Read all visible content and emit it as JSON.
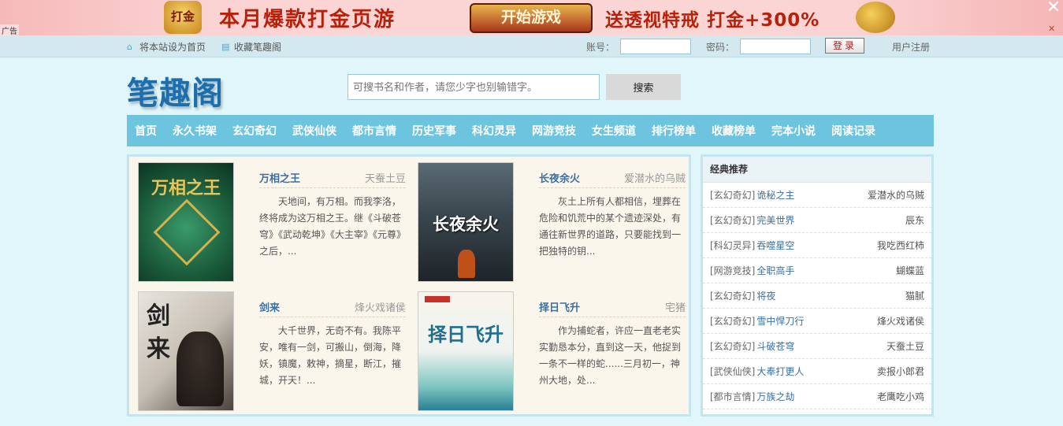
{
  "ad": {
    "label": "广告",
    "logo_text": "打金",
    "text1": "本月爆款打金页游",
    "button": "开始游戏",
    "text2": "送透视特戒 打金+300%",
    "close": "✕",
    "corner": "✕"
  },
  "topbar": {
    "set_home": "将本站设为首页",
    "bookmark": "收藏笔趣阁",
    "account_label": "账号：",
    "password_label": "密码：",
    "login": "登录",
    "register": "用户注册"
  },
  "logo": "笔趣阁",
  "search": {
    "placeholder": "可搜书名和作者，请您少字也别输错字。",
    "button": "搜索"
  },
  "nav": [
    "首页",
    "永久书架",
    "玄幻奇幻",
    "武侠仙侠",
    "都市言情",
    "历史军事",
    "科幻灵异",
    "网游竞技",
    "女生频道",
    "排行榜单",
    "收藏榜单",
    "完本小说",
    "阅读记录"
  ],
  "books": [
    {
      "title": "万相之王",
      "author": "天蚕土豆",
      "desc": "天地间，有万相。而我李洛，终将成为这万相之王。继《斗破苍穹》《武动乾坤》《大主宰》《元尊》之后，...",
      "cover_text": "万相之王"
    },
    {
      "title": "长夜余火",
      "author": "爱潜水的乌贼",
      "desc": "灰土上所有人都相信，埋葬在危险和饥荒中的某个遗迹深处，有通往新世界的道路，只要能找到一把独特的钥...",
      "cover_text": "长夜余火"
    },
    {
      "title": "剑来",
      "author": "烽火戏诸侯",
      "desc": "大千世界，无奇不有。我陈平安，唯有一剑，可搬山，倒海，降妖，镇魔，敕神，摘星，断江，摧城，开天！...",
      "cover_text": "剑来"
    },
    {
      "title": "择日飞升",
      "author": "宅猪",
      "desc": "作为捕蛇者，许应一直老老实实勤恳本分，直到这一天，他捉到一条不一样的蛇......三月初一，神州大地，处...",
      "cover_text": "择日飞升"
    }
  ],
  "classic": {
    "heading": "经典推荐",
    "items": [
      {
        "cat": "[玄幻奇幻]",
        "name": "诡秘之主",
        "author": "爱潜水的乌贼"
      },
      {
        "cat": "[玄幻奇幻]",
        "name": "完美世界",
        "author": "辰东"
      },
      {
        "cat": "[科幻灵异]",
        "name": "吞噬星空",
        "author": "我吃西红柿"
      },
      {
        "cat": "[网游竞技]",
        "name": "全职高手",
        "author": "蝴蝶蓝"
      },
      {
        "cat": "[玄幻奇幻]",
        "name": "将夜",
        "author": "猫腻"
      },
      {
        "cat": "[玄幻奇幻]",
        "name": "雪中悍刀行",
        "author": "烽火戏诸侯"
      },
      {
        "cat": "[玄幻奇幻]",
        "name": "斗破苍穹",
        "author": "天蚕土豆"
      },
      {
        "cat": "[武侠仙侠]",
        "name": "大奉打更人",
        "author": "卖报小郎君"
      },
      {
        "cat": "[都市言情]",
        "name": "万族之劫",
        "author": "老鹰吃小鸡"
      }
    ]
  },
  "colors": {
    "accent": "#6cc4de",
    "link": "#3a6fa0",
    "logo": "#1b6fae"
  }
}
